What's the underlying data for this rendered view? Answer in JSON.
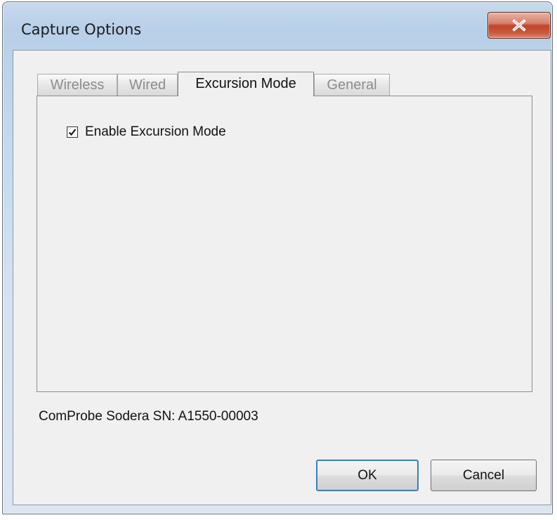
{
  "window": {
    "title": "Capture Options"
  },
  "tabs": [
    {
      "label": "Wireless",
      "active": false
    },
    {
      "label": "Wired",
      "active": false
    },
    {
      "label": "Excursion Mode",
      "active": true
    },
    {
      "label": "General",
      "active": false
    }
  ],
  "excursion": {
    "enable_label": "Enable Excursion Mode",
    "enabled": true
  },
  "footer": {
    "serial_text": "ComProbe Sodera SN: A1550-00003"
  },
  "buttons": {
    "ok_label": "OK",
    "cancel_label": "Cancel"
  },
  "icons": {
    "close": "close-icon",
    "check": "checkmark-icon"
  },
  "colors": {
    "close_button": "#c94f37",
    "window_frame": "#bcd3ea",
    "dialog_bg": "#f0f0f0"
  }
}
